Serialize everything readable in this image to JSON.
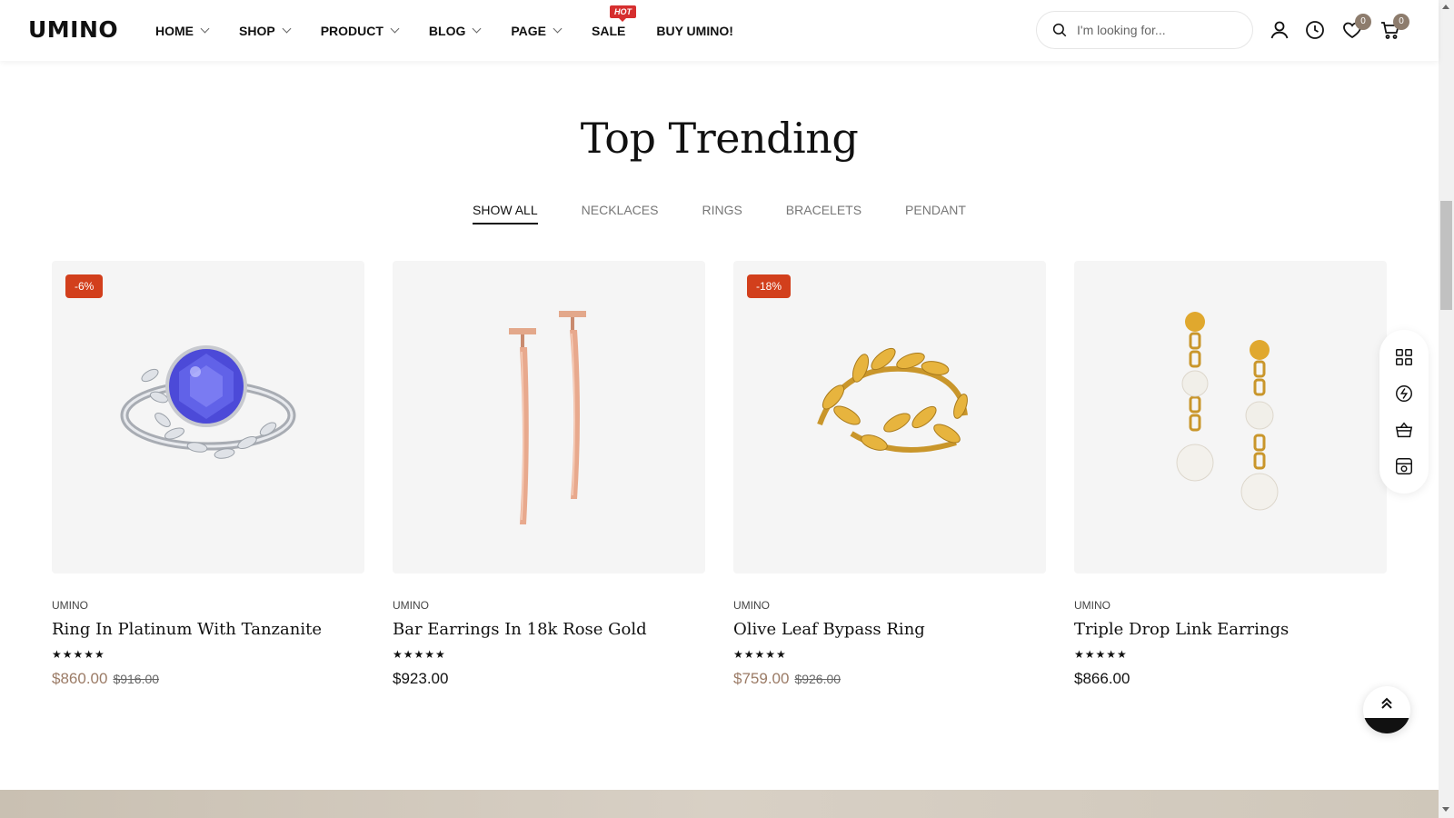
{
  "header": {
    "logo": "UMINO",
    "nav": [
      {
        "label": "HOME",
        "dropdown": true
      },
      {
        "label": "SHOP",
        "dropdown": true
      },
      {
        "label": "PRODUCT",
        "dropdown": true
      },
      {
        "label": "BLOG",
        "dropdown": true
      },
      {
        "label": "PAGE",
        "dropdown": true
      },
      {
        "label": "SALE",
        "dropdown": false,
        "badge": "HOT"
      },
      {
        "label": "BUY UMINO!",
        "dropdown": false
      }
    ],
    "search_placeholder": "I'm looking for...",
    "wishlist_count": "0",
    "cart_count": "0",
    "icons": [
      "search-icon",
      "user-icon",
      "clock-icon",
      "heart-icon",
      "cart-icon"
    ]
  },
  "section": {
    "title": "Top Trending",
    "tabs": [
      "SHOW ALL",
      "NECKLACES",
      "RINGS",
      "BRACELETS",
      "PENDANT"
    ],
    "active_tab": "SHOW ALL"
  },
  "products": [
    {
      "brand": "UMINO",
      "name": "Ring In Platinum With Tanzanite",
      "rating": 5,
      "stars": "★★★★★",
      "price": "$860.00",
      "old_price": "$916.00",
      "badge": "-6%",
      "on_sale": true
    },
    {
      "brand": "UMINO",
      "name": "Bar Earrings In 18k Rose Gold",
      "rating": 5,
      "stars": "★★★★★",
      "price": "$923.00",
      "old_price": "",
      "badge": "",
      "on_sale": false
    },
    {
      "brand": "UMINO",
      "name": "Olive Leaf Bypass Ring",
      "rating": 5,
      "stars": "★★★★★",
      "price": "$759.00",
      "old_price": "$926.00",
      "badge": "-18%",
      "on_sale": true
    },
    {
      "brand": "UMINO",
      "name": "Triple Drop Link Earrings",
      "rating": 5,
      "stars": "★★★★★",
      "price": "$866.00",
      "old_price": "",
      "badge": "",
      "on_sale": false
    }
  ],
  "side_tools": [
    "grid-icon",
    "compare-icon",
    "basket-icon",
    "store-icon"
  ],
  "colors": {
    "sale_badge": "#d23f1c",
    "sale_price": "#9b7b66",
    "hot_badge": "#d62f2f",
    "count_badge": "#8d7c6d"
  }
}
